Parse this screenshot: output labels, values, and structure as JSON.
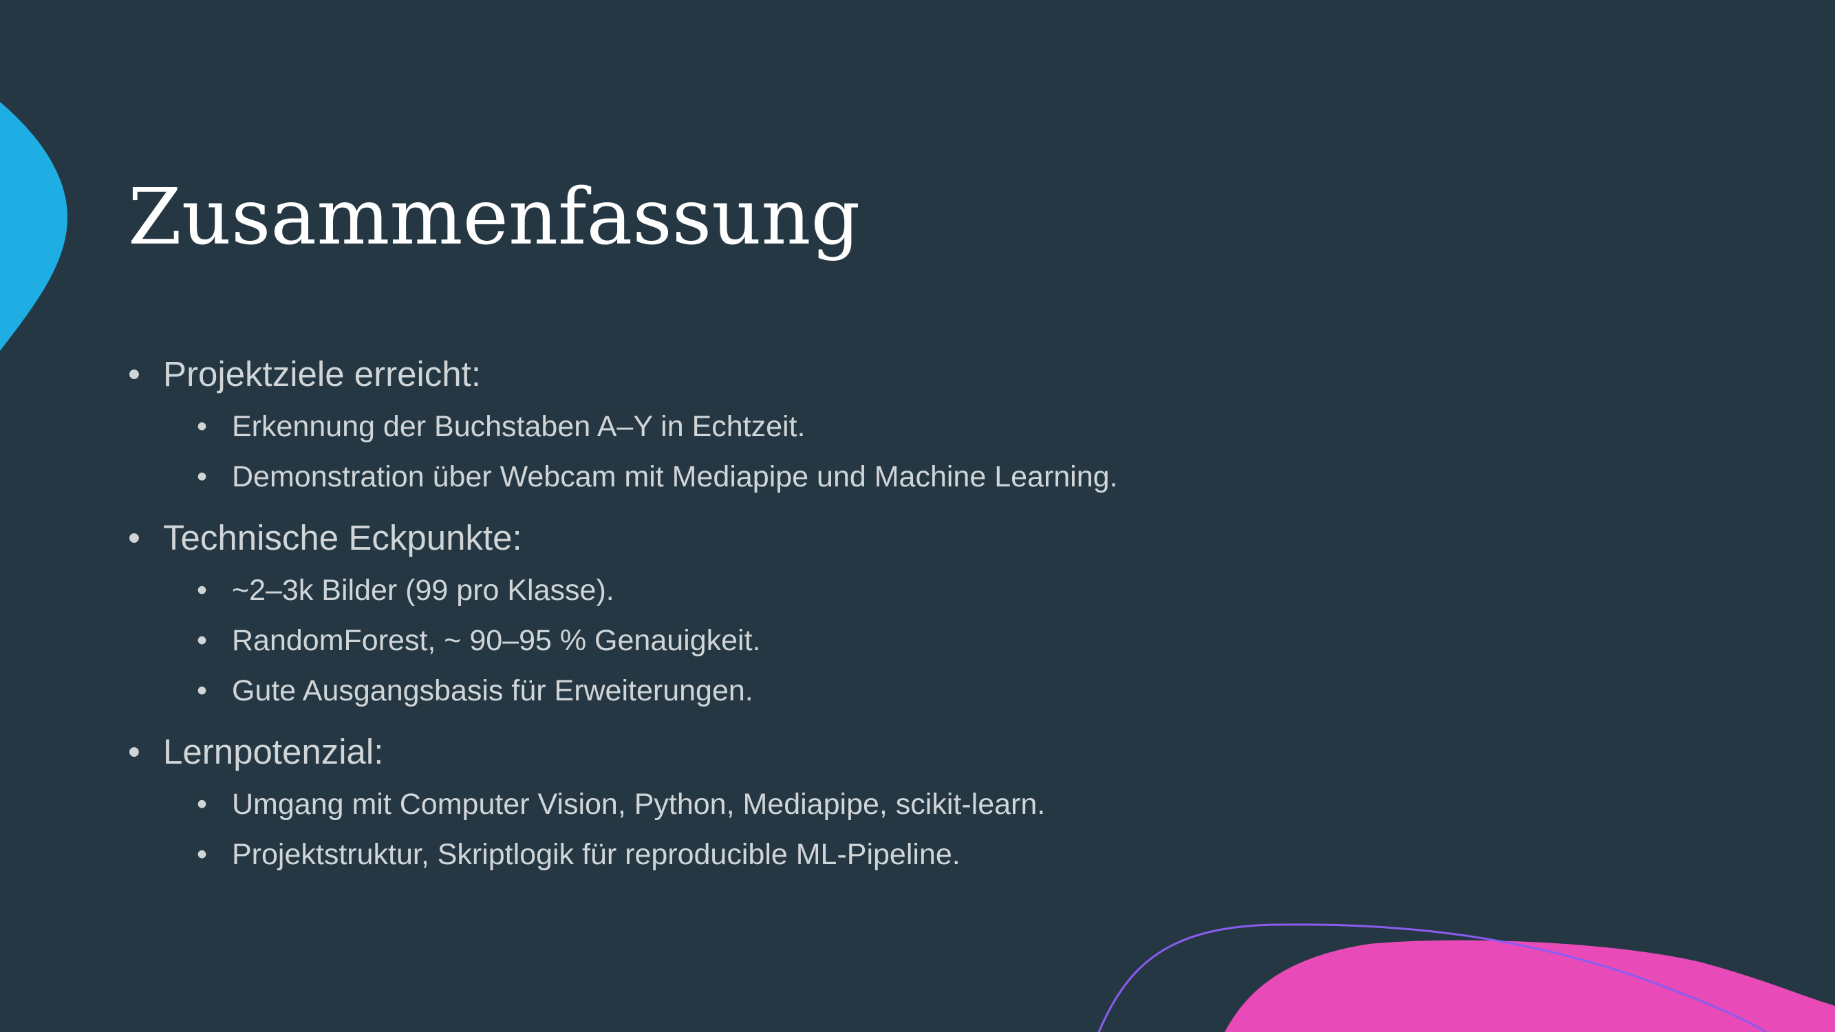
{
  "slide": {
    "title": "Zusammenfassung",
    "bullet_glyph": "•",
    "colors": {
      "background": "#253742",
      "title": "#ffffff",
      "text": "#d0d5d8",
      "accent_blue": "#1eaee3",
      "accent_pink": "#e84ab8",
      "accent_purple_line": "#8a5cf0"
    },
    "groups": [
      {
        "heading": "Projektziele erreicht:",
        "items": [
          "Erkennung der Buchstaben A–Y in Echtzeit.",
          "Demonstration über Webcam mit Mediapipe und Machine Learning."
        ]
      },
      {
        "heading": "Technische Eckpunkte:",
        "items": [
          "~2–3k Bilder (99 pro Klasse).",
          "RandomForest, ~ 90–95 % Genauigkeit.",
          "Gute Ausgangsbasis für Erweiterungen."
        ]
      },
      {
        "heading": "Lernpotenzial:",
        "items": [
          "Umgang mit Computer Vision, Python, Mediapipe, scikit-learn.",
          "Projektstruktur, Skriptlogik für reproducible ML-Pipeline."
        ]
      }
    ]
  }
}
